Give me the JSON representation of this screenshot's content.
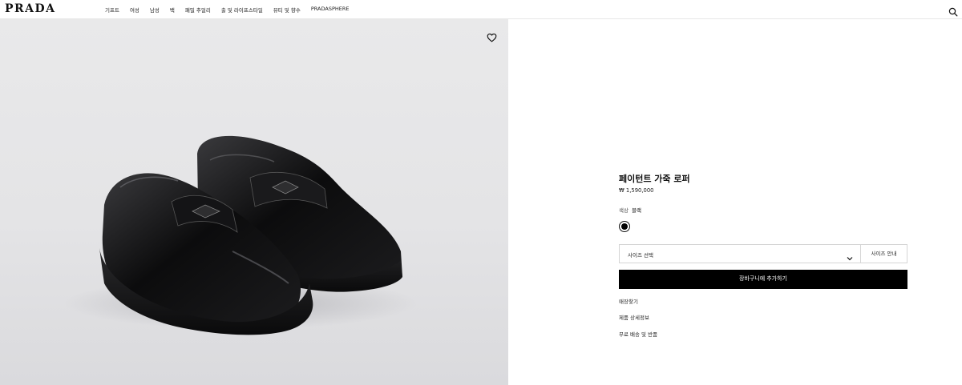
{
  "header": {
    "logo": "PRADA",
    "nav": [
      "기프트",
      "여성",
      "남성",
      "백",
      "패밀 추얼리",
      "출 및 라이프스타일",
      "뷰티 및 향수",
      "PRADASPHERE"
    ]
  },
  "product": {
    "name": "페이턴트 가죽 로퍼",
    "price": "₩ 1,590,000",
    "color_label": "색상",
    "color_value": "블랙",
    "swatch_color": "#000000",
    "size_select_label": "사이즈 선택",
    "size_guide_label": "사이즈 안내",
    "add_to_bag_label": "장바구니에 추가하기",
    "links": [
      "매장찾기",
      "제품 상세정보",
      "무료 배송 및 반품"
    ]
  },
  "icons": {
    "search": "search-icon",
    "wishlist": "heart-icon",
    "chevron": "chevron-down-icon"
  }
}
